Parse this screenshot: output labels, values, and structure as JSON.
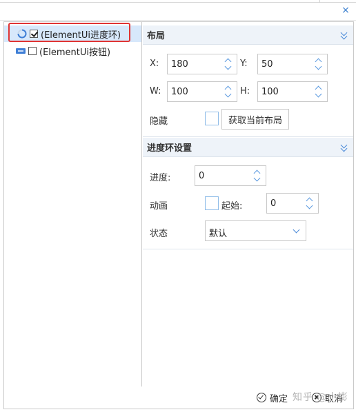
{
  "window": {
    "close_glyph": "×"
  },
  "tree": {
    "items": [
      {
        "label": "(ElementUi进度环)",
        "checked": true,
        "selected": true,
        "icon": "progress-ring-icon"
      },
      {
        "label": "(ElementUi按钮)",
        "checked": false,
        "selected": false,
        "icon": "button-component-icon"
      }
    ]
  },
  "layout_section": {
    "title": "布局",
    "x_label": "X:",
    "x_value": "180",
    "y_label": "Y:",
    "y_value": "50",
    "w_label": "W:",
    "w_value": "100",
    "h_label": "H:",
    "h_value": "100",
    "hidden_label": "隐藏",
    "get_layout_button": "获取当前布局"
  },
  "progress_section": {
    "title": "进度环设置",
    "progress_label": "进度:",
    "progress_value": "0",
    "anim_label": "动画",
    "start_label": "起始:",
    "start_value": "0",
    "state_label": "状态",
    "state_value": "默认"
  },
  "footer": {
    "ok_label": "确定",
    "cancel_label": "取消",
    "watermark": "知乎 @小蟛"
  },
  "colors": {
    "accent": "#3a7fcf",
    "selection_bg": "#d7e8fb",
    "highlight_outline": "#e03434"
  }
}
